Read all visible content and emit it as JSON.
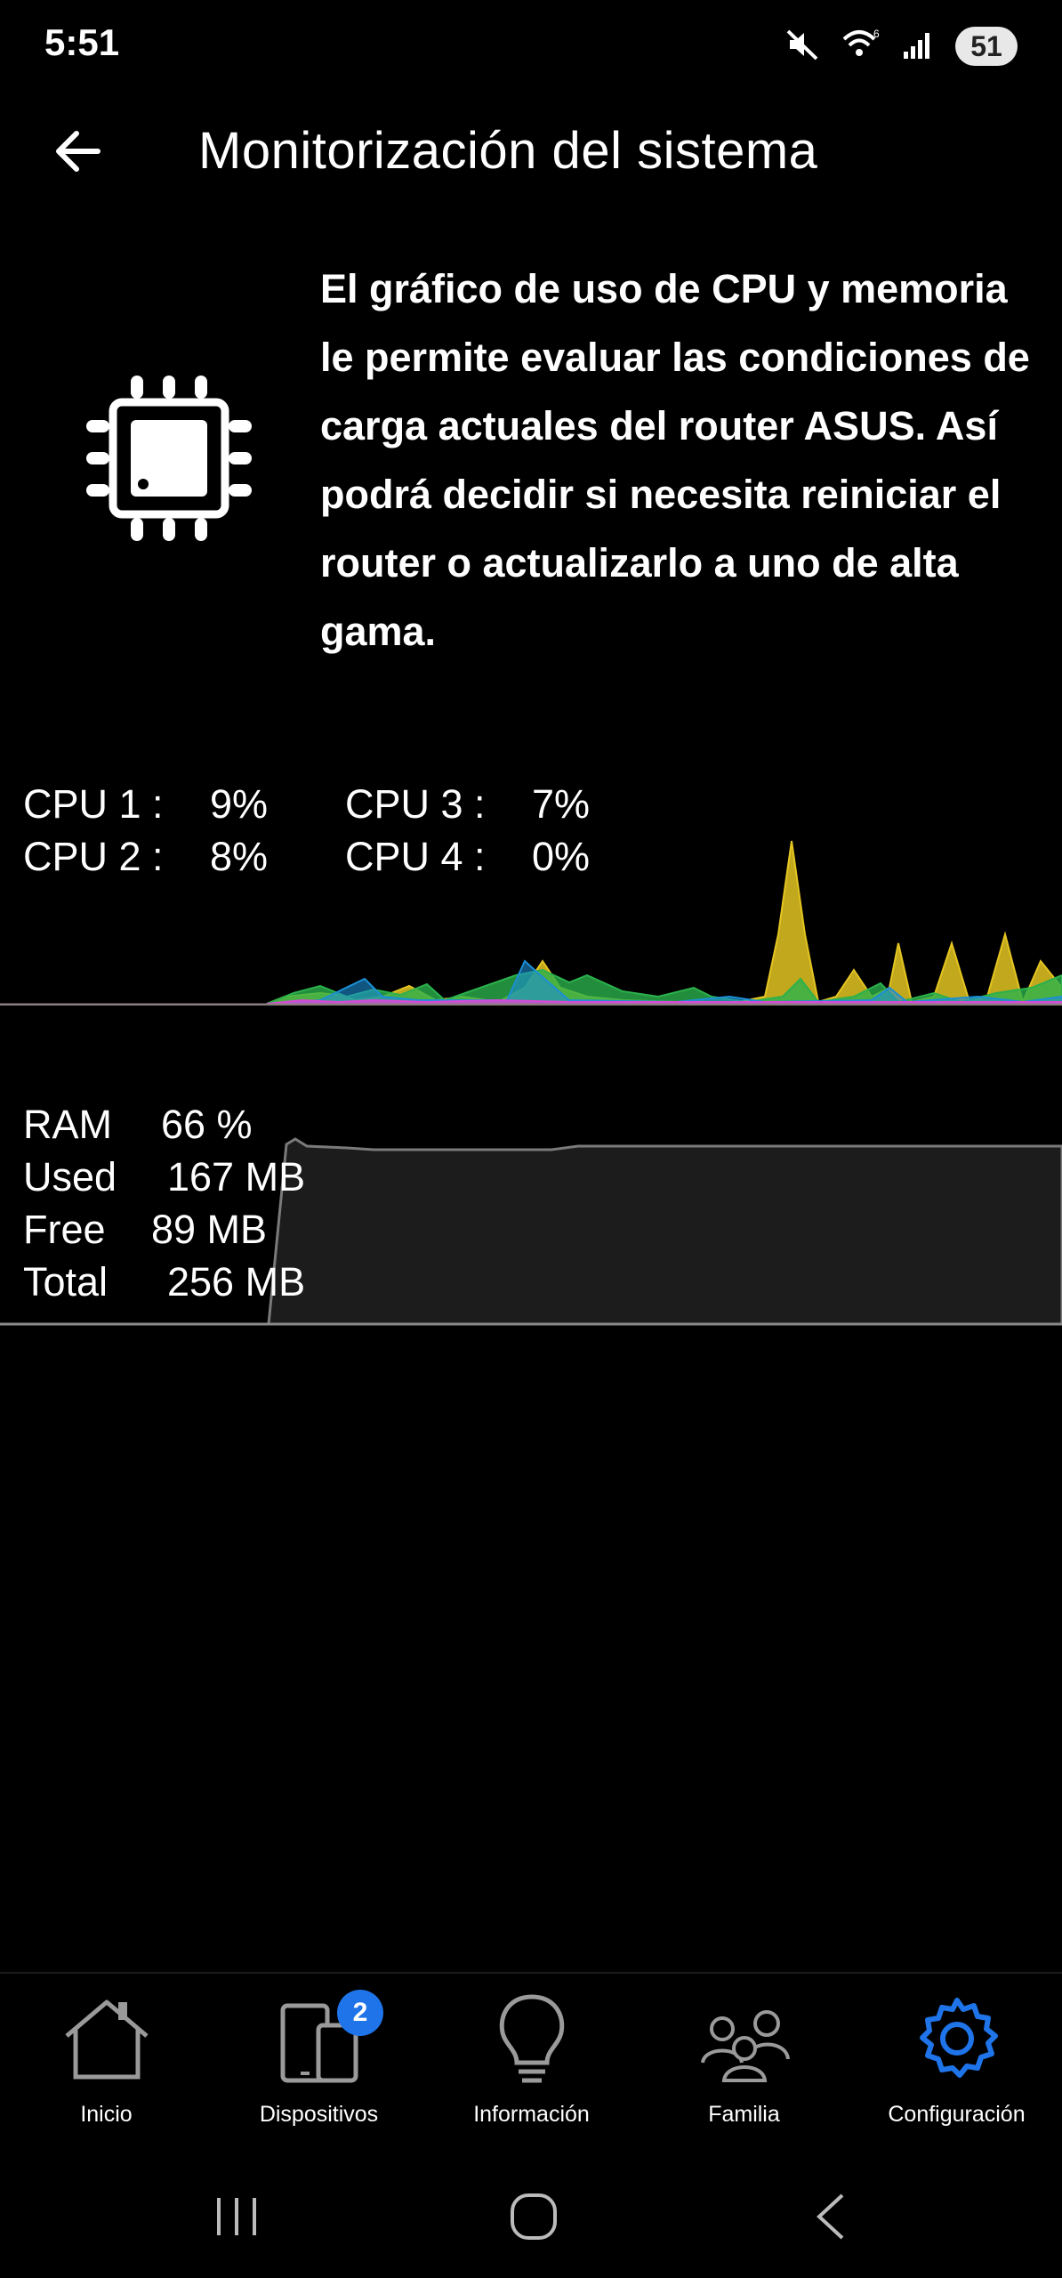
{
  "status": {
    "time": "5:51",
    "battery": "51",
    "wifi_label": "6"
  },
  "header": {
    "title": "Monitorización del sistema"
  },
  "intro": {
    "icon": "cpu-chip-icon",
    "text": "El gráfico de uso de CPU y memoria le permite evaluar las condiciones de carga actuales del router ASUS. Así podrá decidir si necesita reiniciar el router o actualizarlo a uno de alta gama."
  },
  "cpu": {
    "cpu1_label": "CPU 1 :",
    "cpu1_value": "9%",
    "cpu2_label": "CPU 2 :",
    "cpu2_value": "8%",
    "cpu3_label": "CPU 3 :",
    "cpu3_value": "7%",
    "cpu4_label": "CPU 4 :",
    "cpu4_value": "0%"
  },
  "ram": {
    "ram_label": "RAM",
    "ram_value": "66 %",
    "used_label": "Used",
    "used_value": "167 MB",
    "free_label": "Free",
    "free_value": "89 MB",
    "total_label": "Total",
    "total_value": "256 MB"
  },
  "nav": {
    "items": [
      {
        "label": "Inicio",
        "icon": "home-icon"
      },
      {
        "label": "Dispositivos",
        "icon": "devices-icon",
        "badge": "2"
      },
      {
        "label": "Información",
        "icon": "lightbulb-icon"
      },
      {
        "label": "Familia",
        "icon": "family-icon"
      },
      {
        "label": "Configuración",
        "icon": "gear-icon"
      }
    ]
  },
  "colors": {
    "accent": "#1e74e8",
    "cpu1": "#e4c521",
    "cpu2": "#2bb14c",
    "cpu3": "#1c8fd6",
    "cpu4": "#d64bd6"
  }
}
